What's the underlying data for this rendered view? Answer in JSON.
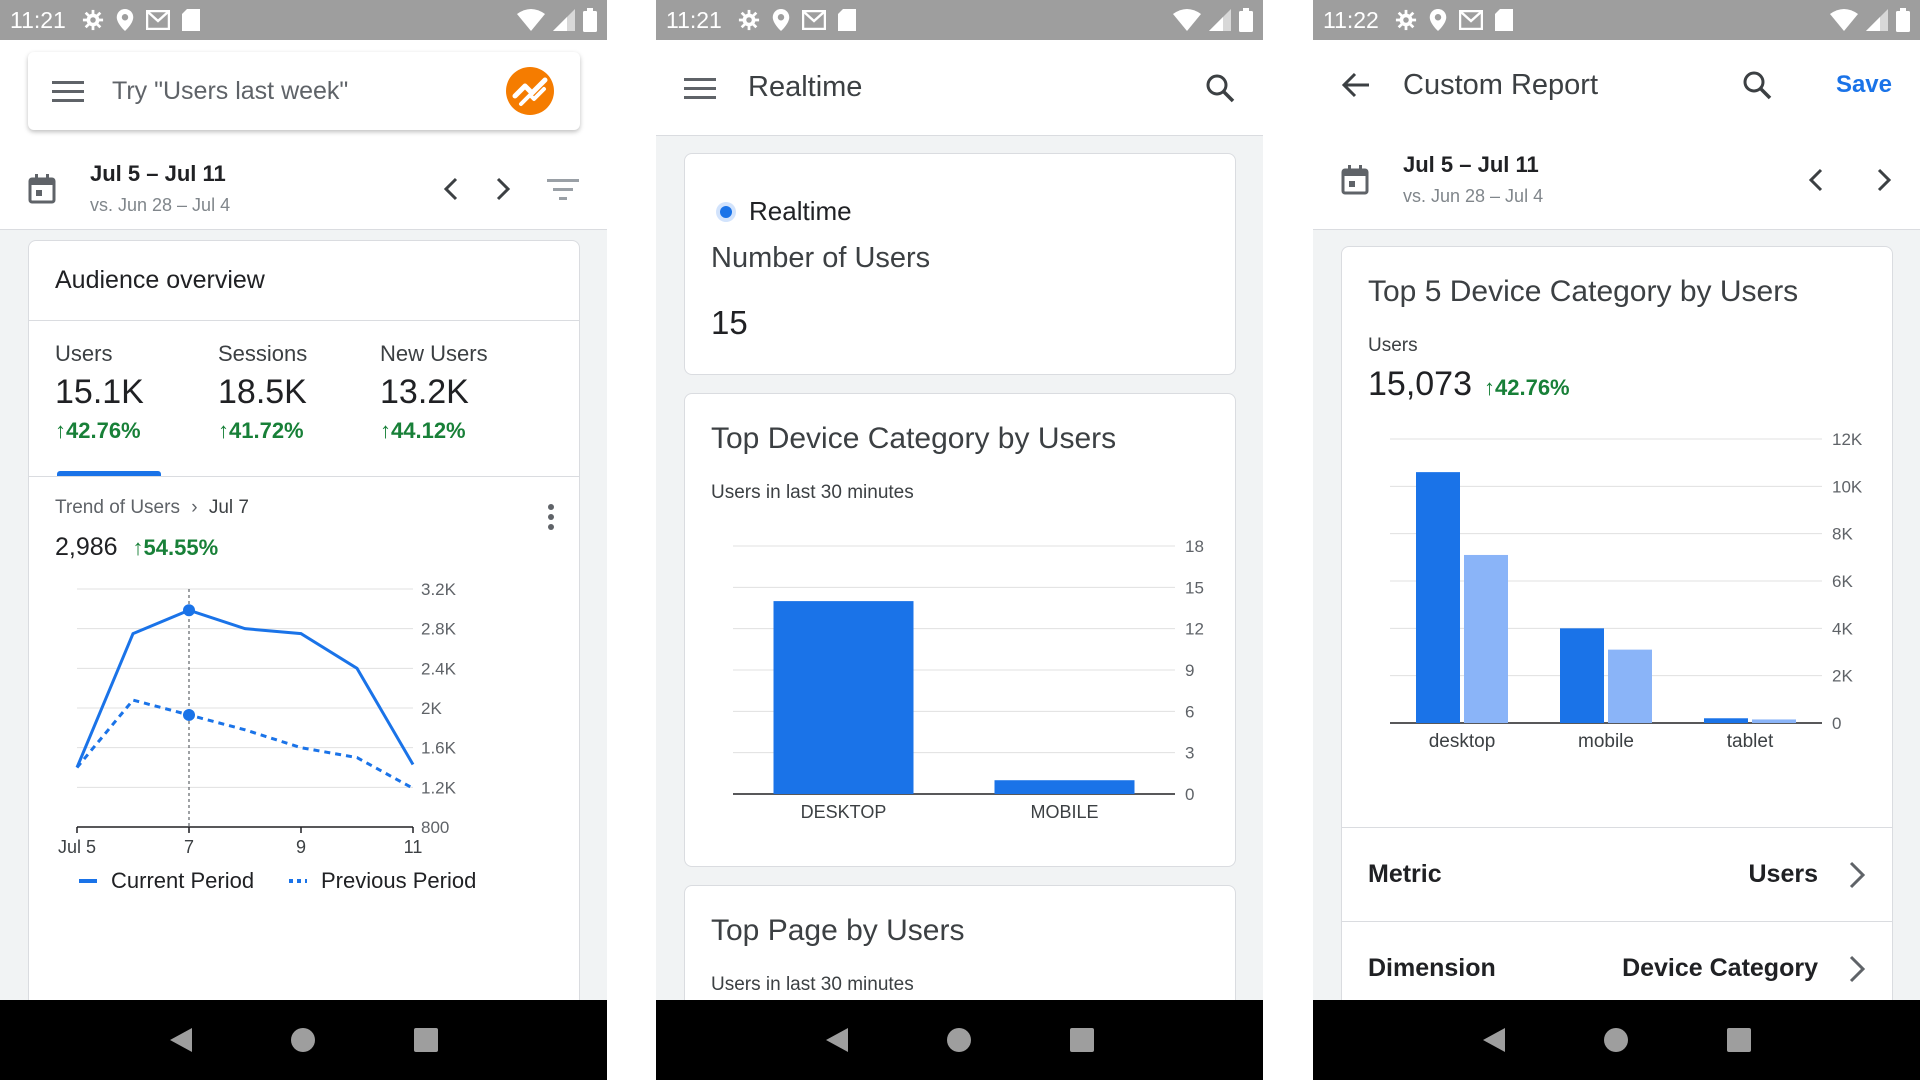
{
  "colors": {
    "accent": "#1a73e8",
    "accent_light": "#8ab4f8",
    "positive": "#188038"
  },
  "phone1": {
    "status": {
      "time": "11:21"
    },
    "search": {
      "placeholder": "Try \"Users last week\""
    },
    "date": {
      "range": "Jul 5 – Jul 11",
      "compare": "vs. Jun 28 – Jul 4"
    },
    "overview": {
      "title": "Audience overview",
      "metrics": [
        {
          "label": "Users",
          "value": "15.1K",
          "delta": "42.76%"
        },
        {
          "label": "Sessions",
          "value": "18.5K",
          "delta": "41.72%"
        },
        {
          "label": "New Users",
          "value": "13.2K",
          "delta": "44.12%"
        }
      ],
      "trend": {
        "label": "Trend of Users",
        "point": "Jul 7",
        "value": "2,986",
        "delta": "54.55%"
      }
    },
    "chart_data": {
      "type": "line",
      "x": [
        "Jul 5",
        "Jul 6",
        "Jul 7",
        "Jul 8",
        "Jul 9",
        "Jul 10",
        "Jul 11"
      ],
      "x_tick_labels": [
        "Jul 5",
        "7",
        "9",
        "11"
      ],
      "y_tick_labels": [
        "3.2K",
        "2.8K",
        "2.4K",
        "2K",
        "1.6K",
        "1.2K",
        "800"
      ],
      "ylim": [
        800,
        3200
      ],
      "series": [
        {
          "name": "Current Period",
          "style": "solid",
          "values": [
            1400,
            2750,
            2986,
            2800,
            2750,
            2400,
            1430
          ]
        },
        {
          "name": "Previous Period",
          "style": "dashed",
          "values": [
            1400,
            2080,
            1930,
            1780,
            1600,
            1500,
            1190
          ]
        }
      ],
      "highlight_x": "Jul 7",
      "legend": "bottom"
    }
  },
  "phone2": {
    "status": {
      "time": "11:21"
    },
    "appbar": {
      "title": "Realtime"
    },
    "realtime": {
      "label": "Realtime",
      "metric": "Number of Users",
      "value": "15"
    },
    "device_card": {
      "title": "Top Device Category by Users",
      "subtitle": "Users in last 30 minutes"
    },
    "chart_data": {
      "type": "bar",
      "categories": [
        "DESKTOP",
        "MOBILE"
      ],
      "values": [
        14,
        1
      ],
      "y_tick_labels": [
        "18",
        "15",
        "12",
        "9",
        "6",
        "3",
        "0"
      ],
      "ylim": [
        0,
        18
      ]
    },
    "page_card": {
      "title": "Top Page by Users",
      "subtitle": "Users in last 30 minutes"
    }
  },
  "phone3": {
    "status": {
      "time": "11:22"
    },
    "appbar": {
      "title": "Custom Report",
      "save": "Save"
    },
    "date": {
      "range": "Jul 5 – Jul 11",
      "compare": "vs. Jun 28 – Jul 4"
    },
    "report": {
      "title": "Top 5 Device Category by Users",
      "metric_label": "Users",
      "value": "15,073",
      "delta": "42.76%"
    },
    "chart_data": {
      "type": "bar",
      "categories": [
        "desktop",
        "mobile",
        "tablet"
      ],
      "series": [
        {
          "values": [
            10600,
            4000,
            200
          ]
        },
        {
          "values": [
            7100,
            3100,
            150
          ]
        }
      ],
      "y_tick_labels": [
        "12K",
        "10K",
        "8K",
        "6K",
        "4K",
        "2K",
        "0"
      ],
      "ylim": [
        0,
        12000
      ]
    },
    "rows": [
      {
        "label": "Metric",
        "value": "Users"
      },
      {
        "label": "Dimension",
        "value": "Device Category"
      }
    ]
  }
}
